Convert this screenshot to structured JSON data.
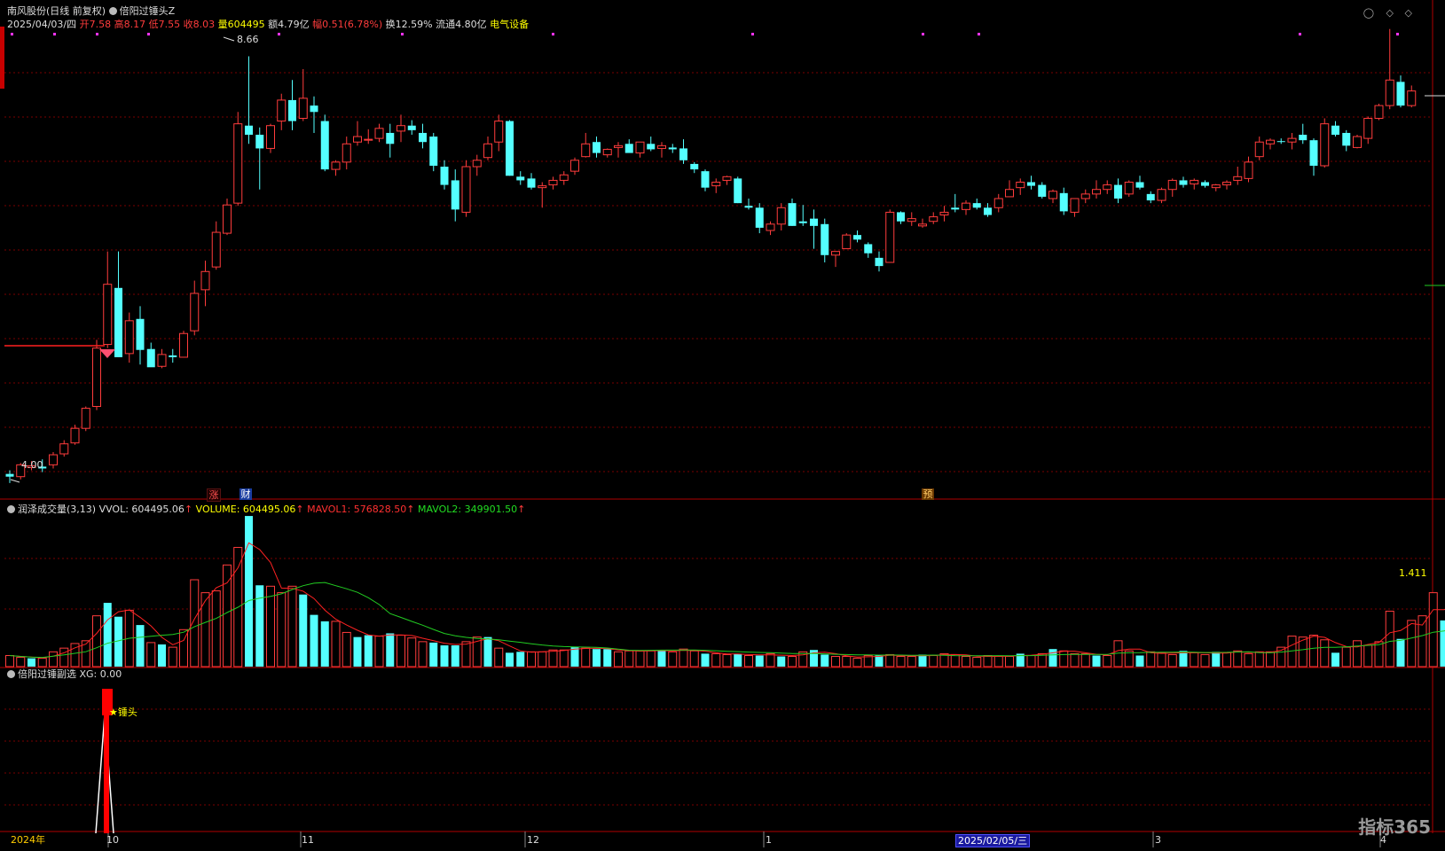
{
  "header": {
    "stock": "南风股份",
    "mode": "(日线 前复权)",
    "formula": "倍阳过锤头Z",
    "date": "2025/04/03/四",
    "open_label": "开",
    "open": "7.58",
    "high_label": "高",
    "high": "8.17",
    "low_label": "低",
    "low": "7.55",
    "close_label": "收",
    "close": "8.03",
    "vol_label": "量",
    "vol": "604495",
    "amt_label": "额",
    "amt": "4.79亿",
    "chg_label": "幅",
    "chg": "0.51(6.78%)",
    "turn_label": "换",
    "turn": "12.59%",
    "float_label": "流通",
    "float": "4.80亿",
    "sector": "电气设备"
  },
  "price_panel": {
    "max_label": "8.66",
    "min_label": "4.00",
    "markers": [
      "涨",
      "财",
      "预"
    ]
  },
  "volume_panel": {
    "title": "润泽成交量(3,13)",
    "vvol_label": "VVOL: 604495.06",
    "volume_label": "VOLUME: 604495.06",
    "mavol1_label": "MAVOL1: 576828.50",
    "mavol2_label": "MAVOL2: 349901.50",
    "right_value": "1.411"
  },
  "signal_panel": {
    "title": "倍阳过锤副选",
    "xg_label": "XG: 0.00",
    "signal_text": "锤头"
  },
  "axis": {
    "labels": [
      "2024年",
      "10",
      "11",
      "12",
      "1",
      "3",
      "4"
    ],
    "cursor_date": "2025/02/05/三"
  },
  "watermark": "指标365",
  "colors": {
    "up": "#ff3c3c",
    "down": "#54ffff",
    "ma1": "#ff2222",
    "ma2": "#22cc22",
    "grid": "#7a0000"
  },
  "chart_data": {
    "type": "candlestick",
    "candles": [
      [
        4.08,
        4.12,
        3.98,
        4.05
      ],
      [
        4.05,
        4.2,
        4.02,
        4.18
      ],
      [
        4.15,
        4.22,
        4.12,
        4.17
      ],
      [
        4.16,
        4.24,
        4.1,
        4.14
      ],
      [
        4.18,
        4.32,
        4.14,
        4.29
      ],
      [
        4.3,
        4.45,
        4.27,
        4.41
      ],
      [
        4.42,
        4.62,
        4.4,
        4.58
      ],
      [
        4.58,
        4.82,
        4.55,
        4.8
      ],
      [
        4.82,
        5.55,
        4.78,
        5.46
      ],
      [
        5.5,
        6.52,
        5.46,
        6.16
      ],
      [
        6.12,
        6.52,
        5.36,
        5.36
      ],
      [
        5.4,
        5.85,
        5.3,
        5.76
      ],
      [
        5.78,
        5.92,
        5.28,
        5.44
      ],
      [
        5.45,
        5.52,
        5.27,
        5.25
      ],
      [
        5.26,
        5.45,
        5.24,
        5.39
      ],
      [
        5.38,
        5.45,
        5.3,
        5.36
      ],
      [
        5.36,
        5.65,
        5.36,
        5.62
      ],
      [
        5.65,
        6.2,
        5.6,
        6.06
      ],
      [
        6.1,
        6.42,
        5.92,
        6.3
      ],
      [
        6.35,
        6.85,
        6.32,
        6.73
      ],
      [
        6.72,
        7.1,
        6.7,
        7.03
      ],
      [
        7.05,
        8.05,
        7.02,
        7.92
      ],
      [
        7.9,
        8.66,
        7.7,
        7.8
      ],
      [
        7.8,
        7.88,
        7.2,
        7.65
      ],
      [
        7.65,
        7.92,
        7.6,
        7.9
      ],
      [
        7.95,
        8.25,
        7.85,
        8.18
      ],
      [
        8.18,
        8.4,
        7.85,
        7.95
      ],
      [
        7.98,
        8.52,
        7.95,
        8.2
      ],
      [
        8.12,
        8.22,
        7.82,
        8.05
      ],
      [
        7.95,
        8.02,
        7.4,
        7.42
      ],
      [
        7.42,
        7.52,
        7.35,
        7.5
      ],
      [
        7.5,
        7.78,
        7.42,
        7.7
      ],
      [
        7.72,
        7.95,
        7.68,
        7.78
      ],
      [
        7.74,
        7.86,
        7.7,
        7.75
      ],
      [
        7.76,
        7.92,
        7.72,
        7.87
      ],
      [
        7.82,
        7.92,
        7.55,
        7.7
      ],
      [
        7.84,
        8.02,
        7.72,
        7.9
      ],
      [
        7.9,
        7.96,
        7.8,
        7.85
      ],
      [
        7.82,
        7.92,
        7.65,
        7.72
      ],
      [
        7.78,
        7.82,
        7.4,
        7.46
      ],
      [
        7.45,
        7.52,
        7.2,
        7.25
      ],
      [
        7.3,
        7.42,
        6.85,
        6.98
      ],
      [
        6.95,
        7.52,
        6.9,
        7.45
      ],
      [
        7.45,
        7.58,
        7.35,
        7.52
      ],
      [
        7.55,
        7.78,
        7.52,
        7.7
      ],
      [
        7.72,
        8.02,
        7.62,
        7.95
      ],
      [
        7.95,
        7.96,
        7.35,
        7.35
      ],
      [
        7.34,
        7.4,
        7.25,
        7.3
      ],
      [
        7.32,
        7.38,
        7.2,
        7.22
      ],
      [
        7.22,
        7.28,
        7.0,
        7.24
      ],
      [
        7.25,
        7.34,
        7.2,
        7.3
      ],
      [
        7.3,
        7.4,
        7.25,
        7.36
      ],
      [
        7.4,
        7.55,
        7.36,
        7.52
      ],
      [
        7.56,
        7.82,
        7.55,
        7.7
      ],
      [
        7.72,
        7.78,
        7.55,
        7.6
      ],
      [
        7.58,
        7.65,
        7.55,
        7.64
      ],
      [
        7.66,
        7.72,
        7.55,
        7.68
      ],
      [
        7.7,
        7.75,
        7.62,
        7.6
      ],
      [
        7.6,
        7.72,
        7.55,
        7.72
      ],
      [
        7.7,
        7.78,
        7.62,
        7.64
      ],
      [
        7.65,
        7.72,
        7.55,
        7.68
      ],
      [
        7.66,
        7.7,
        7.6,
        7.64
      ],
      [
        7.65,
        7.75,
        7.48,
        7.52
      ],
      [
        7.48,
        7.5,
        7.38,
        7.42
      ],
      [
        7.4,
        7.42,
        7.18,
        7.22
      ],
      [
        7.24,
        7.32,
        7.16,
        7.28
      ],
      [
        7.3,
        7.35,
        7.25,
        7.34
      ],
      [
        7.32,
        7.34,
        7.05,
        7.05
      ],
      [
        7.02,
        7.1,
        6.98,
        7.0
      ],
      [
        7.0,
        7.05,
        6.72,
        6.78
      ],
      [
        6.75,
        6.85,
        6.7,
        6.82
      ],
      [
        6.82,
        7.05,
        6.75,
        7.0
      ],
      [
        7.05,
        7.1,
        6.8,
        6.8
      ],
      [
        6.85,
        7.03,
        6.8,
        6.83
      ],
      [
        6.88,
        6.98,
        6.55,
        6.8
      ],
      [
        6.82,
        6.88,
        6.4,
        6.48
      ],
      [
        6.48,
        6.52,
        6.35,
        6.52
      ],
      [
        6.55,
        6.72,
        6.55,
        6.7
      ],
      [
        6.7,
        6.75,
        6.62,
        6.65
      ],
      [
        6.6,
        6.62,
        6.45,
        6.5
      ],
      [
        6.45,
        6.52,
        6.3,
        6.36
      ],
      [
        6.4,
        6.98,
        6.4,
        6.95
      ],
      [
        6.95,
        6.96,
        6.82,
        6.85
      ],
      [
        6.85,
        6.95,
        6.8,
        6.88
      ],
      [
        6.8,
        6.88,
        6.78,
        6.82
      ],
      [
        6.85,
        6.95,
        6.82,
        6.9
      ],
      [
        6.92,
        7.02,
        6.85,
        6.95
      ],
      [
        7.0,
        7.15,
        6.95,
        6.98
      ],
      [
        6.98,
        7.08,
        6.92,
        7.05
      ],
      [
        7.05,
        7.1,
        6.98,
        7.0
      ],
      [
        7.0,
        7.05,
        6.9,
        6.92
      ],
      [
        7.0,
        7.15,
        6.95,
        7.1
      ],
      [
        7.12,
        7.3,
        7.12,
        7.2
      ],
      [
        7.22,
        7.32,
        7.14,
        7.28
      ],
      [
        7.28,
        7.35,
        7.2,
        7.24
      ],
      [
        7.25,
        7.28,
        7.1,
        7.12
      ],
      [
        7.1,
        7.2,
        7.05,
        7.18
      ],
      [
        7.16,
        7.22,
        6.92,
        6.96
      ],
      [
        6.95,
        7.0,
        6.9,
        7.1
      ],
      [
        7.1,
        7.2,
        7.05,
        7.15
      ],
      [
        7.15,
        7.3,
        7.1,
        7.2
      ],
      [
        7.2,
        7.3,
        7.15,
        7.25
      ],
      [
        7.25,
        7.32,
        7.05,
        7.1
      ],
      [
        7.15,
        7.3,
        7.12,
        7.28
      ],
      [
        7.28,
        7.35,
        7.2,
        7.22
      ],
      [
        7.15,
        7.18,
        7.05,
        7.08
      ],
      [
        7.08,
        7.22,
        7.05,
        7.2
      ],
      [
        7.2,
        7.32,
        7.12,
        7.3
      ],
      [
        7.3,
        7.34,
        7.22,
        7.25
      ],
      [
        7.26,
        7.32,
        7.2,
        7.3
      ],
      [
        7.28,
        7.3,
        7.22,
        7.24
      ],
      [
        7.22,
        7.26,
        7.18,
        7.25
      ],
      [
        7.25,
        7.3,
        7.2,
        7.28
      ],
      [
        7.3,
        7.45,
        7.25,
        7.34
      ],
      [
        7.32,
        7.56,
        7.28,
        7.5
      ],
      [
        7.56,
        7.78,
        7.52,
        7.72
      ],
      [
        7.7,
        7.76,
        7.64,
        7.74
      ],
      [
        7.73,
        7.76,
        7.7,
        7.72
      ],
      [
        7.72,
        7.82,
        7.64,
        7.76
      ],
      [
        7.8,
        7.92,
        7.7,
        7.74
      ],
      [
        7.74,
        7.76,
        7.35,
        7.46
      ],
      [
        7.46,
        7.98,
        7.44,
        7.92
      ],
      [
        7.9,
        7.95,
        7.78,
        7.8
      ],
      [
        7.82,
        7.85,
        7.62,
        7.68
      ],
      [
        7.66,
        7.8,
        7.65,
        7.78
      ],
      [
        7.76,
        8.0,
        7.7,
        7.98
      ],
      [
        7.98,
        8.14,
        7.96,
        8.12
      ],
      [
        8.12,
        8.96,
        8.08,
        8.4
      ],
      [
        8.38,
        8.45,
        8.1,
        8.12
      ],
      [
        8.12,
        8.34,
        8.1,
        8.28
      ]
    ],
    "volume": [
      [
        12,
        1
      ],
      [
        10,
        1
      ],
      [
        9,
        0
      ],
      [
        9,
        1
      ],
      [
        16,
        1
      ],
      [
        20,
        1
      ],
      [
        25,
        1
      ],
      [
        28,
        1
      ],
      [
        55,
        1
      ],
      [
        69,
        0
      ],
      [
        54,
        0
      ],
      [
        61,
        1
      ],
      [
        45,
        0
      ],
      [
        26,
        1
      ],
      [
        24,
        0
      ],
      [
        21,
        1
      ],
      [
        40,
        1
      ],
      [
        94,
        1
      ],
      [
        80,
        1
      ],
      [
        82,
        1
      ],
      [
        110,
        1
      ],
      [
        129,
        1
      ],
      [
        163,
        0
      ],
      [
        88,
        0
      ],
      [
        87,
        1
      ],
      [
        80,
        1
      ],
      [
        87,
        1
      ],
      [
        78,
        0
      ],
      [
        56,
        0
      ],
      [
        49,
        0
      ],
      [
        49,
        1
      ],
      [
        37,
        1
      ],
      [
        32,
        0
      ],
      [
        34,
        0
      ],
      [
        33,
        1
      ],
      [
        36,
        0
      ],
      [
        34,
        1
      ],
      [
        31,
        1
      ],
      [
        27,
        1
      ],
      [
        26,
        0
      ],
      [
        23,
        0
      ],
      [
        23,
        0
      ],
      [
        27,
        1
      ],
      [
        32,
        1
      ],
      [
        32,
        0
      ],
      [
        20,
        1
      ],
      [
        15,
        0
      ],
      [
        16,
        0
      ],
      [
        16,
        1
      ],
      [
        16,
        1
      ],
      [
        18,
        1
      ],
      [
        18,
        1
      ],
      [
        21,
        0
      ],
      [
        20,
        1
      ],
      [
        19,
        0
      ],
      [
        19,
        0
      ],
      [
        16,
        1
      ],
      [
        17,
        1
      ],
      [
        17,
        1
      ],
      [
        17,
        1
      ],
      [
        18,
        0
      ],
      [
        16,
        1
      ],
      [
        19,
        1
      ],
      [
        17,
        1
      ],
      [
        14,
        0
      ],
      [
        14,
        1
      ],
      [
        13,
        1
      ],
      [
        14,
        0
      ],
      [
        12,
        1
      ],
      [
        12,
        0
      ],
      [
        14,
        1
      ],
      [
        11,
        0
      ],
      [
        11,
        1
      ],
      [
        16,
        1
      ],
      [
        18,
        0
      ],
      [
        13,
        0
      ],
      [
        11,
        1
      ],
      [
        11,
        1
      ],
      [
        9,
        1
      ],
      [
        12,
        1
      ],
      [
        12,
        0
      ],
      [
        13,
        1
      ],
      [
        11,
        1
      ],
      [
        11,
        1
      ],
      [
        13,
        0
      ],
      [
        12,
        1
      ],
      [
        14,
        1
      ],
      [
        13,
        1
      ],
      [
        11,
        1
      ],
      [
        10,
        1
      ],
      [
        12,
        1
      ],
      [
        11,
        1
      ],
      [
        11,
        1
      ],
      [
        14,
        0
      ],
      [
        12,
        1
      ],
      [
        14,
        1
      ],
      [
        19,
        0
      ],
      [
        17,
        1
      ],
      [
        14,
        1
      ],
      [
        14,
        1
      ],
      [
        12,
        0
      ],
      [
        12,
        1
      ],
      [
        28,
        1
      ],
      [
        17,
        1
      ],
      [
        12,
        0
      ],
      [
        16,
        1
      ],
      [
        15,
        1
      ],
      [
        13,
        1
      ],
      [
        17,
        0
      ],
      [
        15,
        1
      ],
      [
        13,
        1
      ],
      [
        16,
        0
      ],
      [
        15,
        1
      ],
      [
        17,
        1
      ],
      [
        14,
        1
      ],
      [
        16,
        1
      ],
      [
        16,
        1
      ],
      [
        21,
        1
      ],
      [
        33,
        1
      ],
      [
        32,
        1
      ],
      [
        34,
        1
      ],
      [
        29,
        1
      ],
      [
        15,
        0
      ],
      [
        21,
        1
      ],
      [
        28,
        1
      ],
      [
        23,
        1
      ],
      [
        27,
        1
      ],
      [
        60,
        1
      ],
      [
        30,
        0
      ],
      [
        50,
        1
      ],
      [
        55,
        1
      ],
      [
        80,
        1
      ],
      [
        50,
        0
      ],
      [
        70,
        1
      ]
    ]
  }
}
